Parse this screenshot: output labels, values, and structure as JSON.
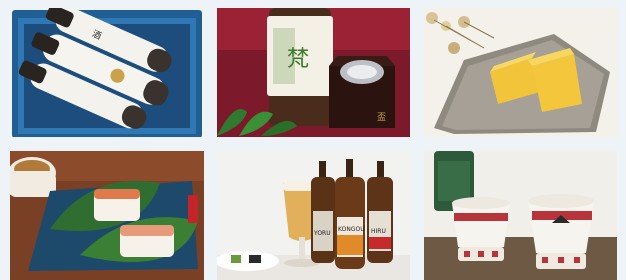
{
  "photos": [
    {
      "subject": "sake-gift-box",
      "label_marks": [
        "酒",
        "⊙"
      ]
    },
    {
      "subject": "sake-bottle-masu",
      "label_marks": [
        "梵",
        "盃"
      ]
    },
    {
      "subject": "tamagoyaki-plate",
      "label_marks": []
    },
    {
      "subject": "pressed-sushi-leaves",
      "label_marks": []
    },
    {
      "subject": "craft-beer-bottles",
      "label_marks": [
        "YORU",
        "KONGOU",
        "HIRU"
      ]
    },
    {
      "subject": "ceramic-cups",
      "label_marks": []
    }
  ],
  "colors": {
    "page_bg": "#eef3f8",
    "gift_box": "#1f5f96",
    "red_cloth": "#8c2030",
    "slate_plate": "#9a958b",
    "beer_amber": "#d6a23c"
  }
}
